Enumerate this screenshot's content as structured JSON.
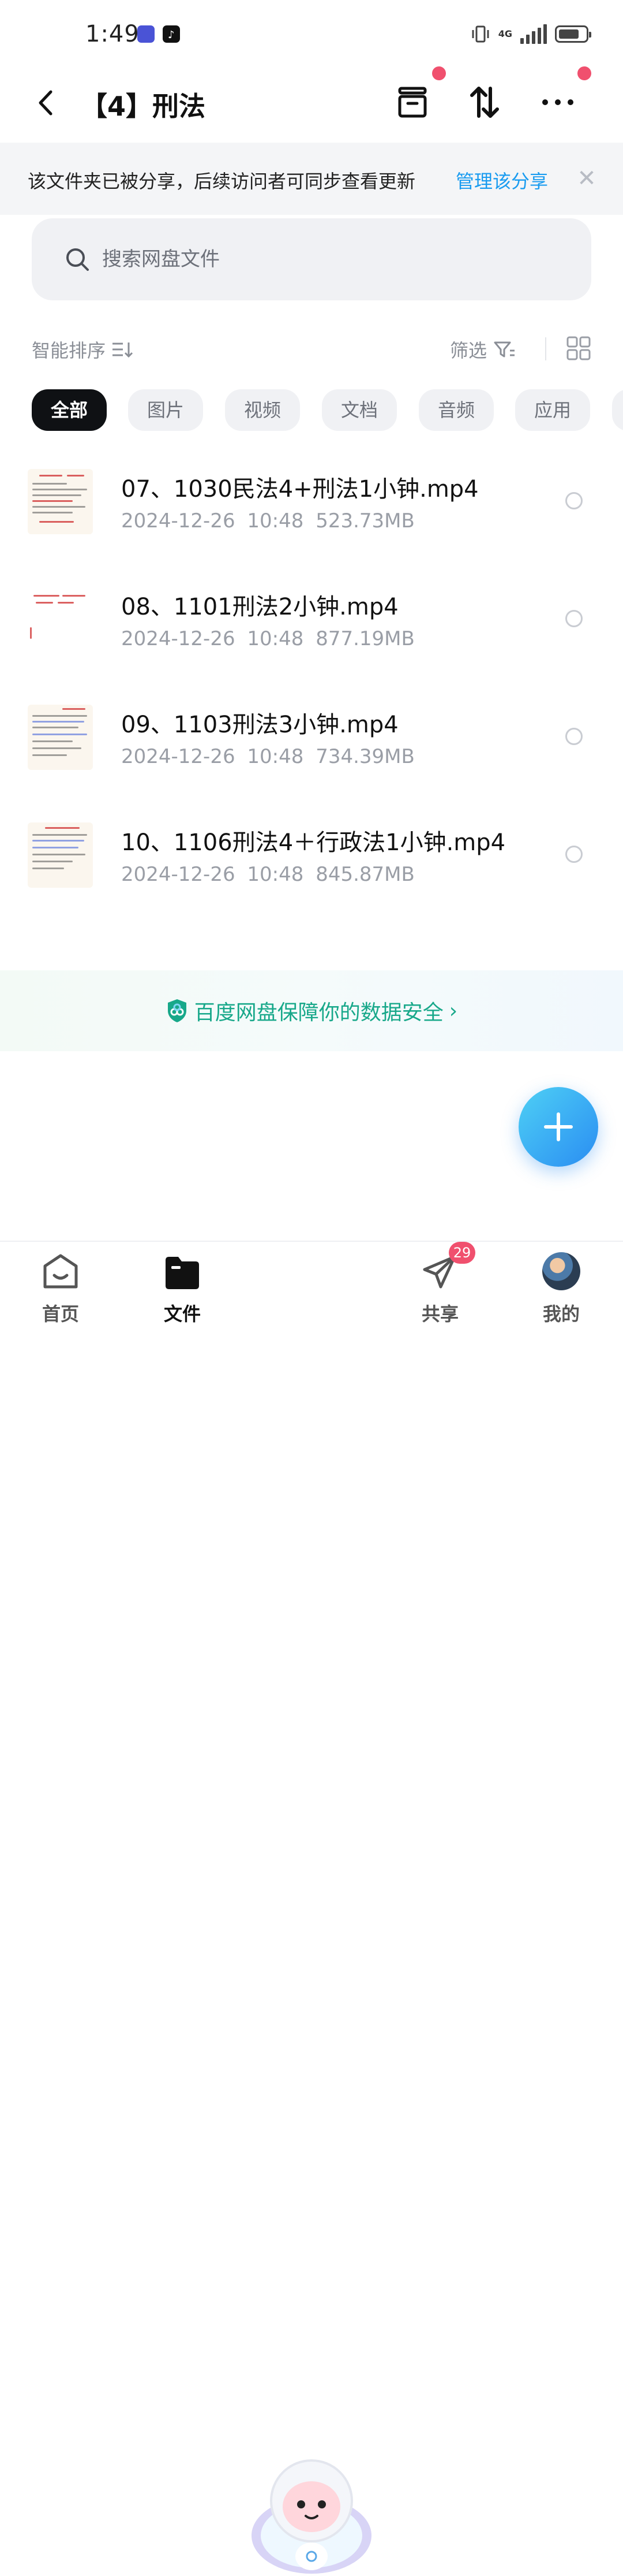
{
  "status_bar": {
    "time": "1:49",
    "network": "4G",
    "notification_icons": [
      "tieba-icon",
      "tiktok-icon"
    ]
  },
  "header": {
    "title": "【4】刑法"
  },
  "share_banner": {
    "text": "该文件夹已被分享，后续访问者可同步查看更新",
    "link": "管理该分享",
    "close": "✕"
  },
  "search": {
    "placeholder": "搜索网盘文件"
  },
  "sort_bar": {
    "sort_label": "智能排序",
    "filter_label": "筛选"
  },
  "chips": [
    {
      "label": "全部",
      "active": true
    },
    {
      "label": "图片",
      "active": false
    },
    {
      "label": "视频",
      "active": false
    },
    {
      "label": "文档",
      "active": false
    },
    {
      "label": "音频",
      "active": false
    },
    {
      "label": "应用",
      "active": false
    }
  ],
  "files": [
    {
      "name": "07、1030民法4+刑法1小钟.mp4",
      "date": "2024-12-26",
      "time": "10:48",
      "size": "523.73MB"
    },
    {
      "name": "08、1101刑法2小钟.mp4",
      "date": "2024-12-26",
      "time": "10:48",
      "size": "877.19MB"
    },
    {
      "name": "09、1103刑法3小钟.mp4",
      "date": "2024-12-26",
      "time": "10:48",
      "size": "734.39MB"
    },
    {
      "name": "10、1106刑法4＋行政法1小钟.mp4",
      "date": "2024-12-26",
      "time": "10:48",
      "size": "845.87MB"
    }
  ],
  "safety_banner": {
    "text": "百度网盘保障你的数据安全",
    "chevron": "›"
  },
  "bottom_nav": {
    "home": "首页",
    "files": "文件",
    "share": "共享",
    "share_badge": "29",
    "me": "我的"
  },
  "colors": {
    "accent": "#1a9cf0",
    "badge": "#f0506e",
    "safety": "#18a88a",
    "fab": "#2a8df2"
  }
}
